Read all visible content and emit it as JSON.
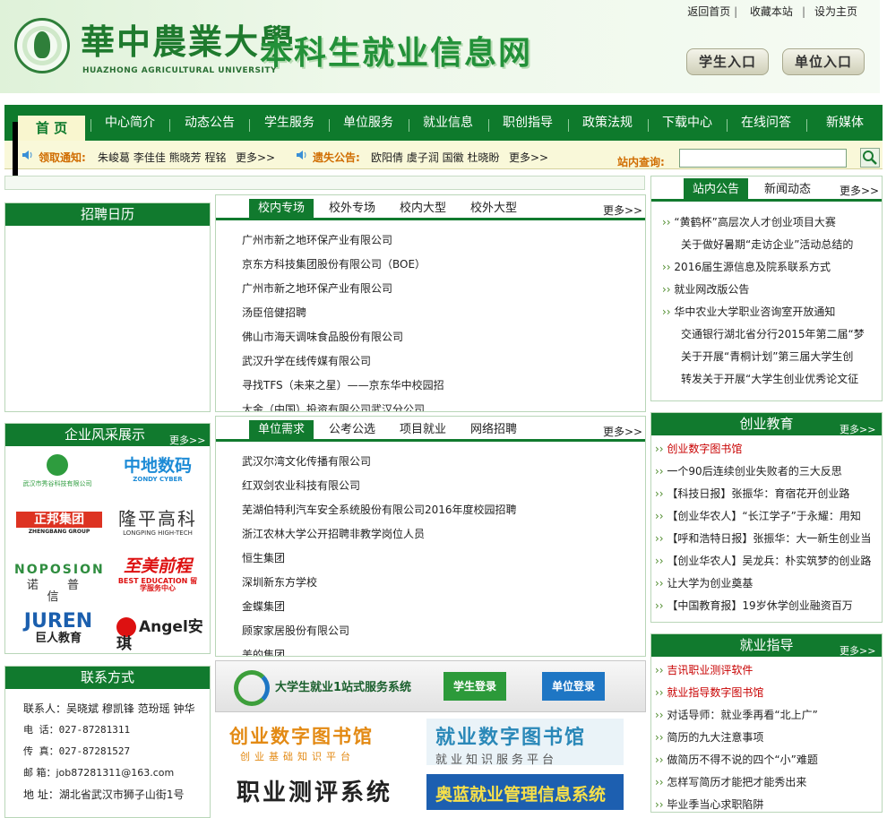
{
  "header": {
    "calligraphy": "華中農業大學",
    "univ_en": "HUAZHONG AGRICULTURAL UNIVERSITY",
    "site_title": "本科生就业信息网",
    "top_links": [
      "返回首页",
      "收藏本站",
      "设为主页"
    ],
    "student_entry": "学生入口",
    "company_entry": "单位入口"
  },
  "nav": [
    "首 页",
    "中心简介",
    "动态公告",
    "学生服务",
    "单位服务",
    "就业信息",
    "职创指导",
    "政策法规",
    "下载中心",
    "在线问答",
    "新媒体"
  ],
  "notice": {
    "label1": "领取通知:",
    "names1": "朱峻葛 李佳佳 熊晓芳 程铭",
    "more1": "更多>>",
    "label2": "遗失公告:",
    "names2": "欧阳倩 虞子润 国徽 杜晓盼",
    "more2": "更多>>",
    "search_label": "站内查询:"
  },
  "calendar": {
    "title": "招聘日历"
  },
  "recruit": {
    "tabs": [
      "校内专场",
      "校外专场",
      "校内大型",
      "校外大型"
    ],
    "more": "更多>>",
    "items": [
      "广州市新之地环保产业有限公司",
      "京东方科技集团股份有限公司（BOE）",
      "广州市新之地环保产业有限公司",
      "汤臣倍健招聘",
      "佛山市海天调味食品股份有限公司",
      "武汉升学在线传媒有限公司",
      "寻找TFS（未来之星）——京东华中校园招",
      "大金（中国）投资有限公司武汉分公司"
    ]
  },
  "demand": {
    "tabs": [
      "单位需求",
      "公考公选",
      "项目就业",
      "网络招聘"
    ],
    "more": "更多>>",
    "items": [
      "武汉尔湾文化传播有限公司",
      "红双剑农业科技有限公司",
      "芜湖伯特利汽车安全系统股份有限公司2016年度校园招聘",
      "浙江农林大学公开招聘非教学岗位人员",
      "恒生集团",
      "深圳新东方学校",
      "金蝶集团",
      "顾家家居股份有限公司",
      "美的集团"
    ]
  },
  "companies": {
    "title": "企业风采展示",
    "more": "更多>>",
    "logos": [
      {
        "name": "武汉市秀谷科技有限公司",
        "sub": ""
      },
      {
        "name": "中地数码",
        "sub": "ZONDY CYBER"
      },
      {
        "name": "正邦集团",
        "sub": "ZHENGBANG GROUP"
      },
      {
        "name": "隆平高科",
        "sub": "LONGPING HIGH-TECH"
      },
      {
        "name": "NOPOSION",
        "sub": "诺 普 信"
      },
      {
        "name": "至美前程",
        "sub": "BEST EDUCATION 留学服务中心"
      },
      {
        "name": "JUREN",
        "sub": "巨人教育"
      },
      {
        "name": "Angel安琪",
        "sub": ""
      }
    ]
  },
  "contact": {
    "title": "联系方式",
    "lines": [
      "联系人：吴晓斌 穆凯锋 范玢瑶 钟华",
      "电 话：027-87281311",
      "传 真：027-87281527",
      "邮 箱：job87281311@163.com",
      "地 址：湖北省武汉市狮子山街1号"
    ]
  },
  "banners": {
    "onestop": "大学生就业1站式服务系统",
    "student_login": "学生登录",
    "company_login": "单位登录",
    "cy_lib": "创业数字图书馆",
    "cy_lib_sub": "创业基础知识平台",
    "jy_lib": "就业数字图书馆",
    "jy_lib_sub": "就业知识服务平台",
    "test": "职业测评系统",
    "aolan": "奥蓝就业管理信息系统"
  },
  "announce": {
    "tabs": [
      "站内公告",
      "新闻动态"
    ],
    "more": "更多>>",
    "items": [
      "“黄鹤杯”高层次人才创业项目大赛",
      "关于做好暑期“走访企业”活动总结的",
      "2016届生源信息及院系联系方式",
      "就业网改版公告",
      "华中农业大学职业咨询室开放通知",
      "交通银行湖北省分行2015年第二届“梦",
      "关于开展“青桐计划”第三届大学生创",
      "转发关于开展“大学生创业优秀论文征"
    ]
  },
  "entrepreneurship": {
    "title": "创业教育",
    "more": "更多>>",
    "items": [
      "创业数字图书馆",
      "一个90后连续创业失败者的三大反思",
      "【科技日报】张振华：育宿花开创业路",
      "【创业华农人】“长江学子”于永耀：用知",
      "【呼和浩特日报】张振华：大一新生创业当",
      "【创业华农人】吴龙兵：朴实筑梦的创业路",
      "让大学为创业奠基",
      "【中国教育报】19岁休学创业融资百万"
    ]
  },
  "guidance": {
    "title": "就业指导",
    "more": "更多>>",
    "items": [
      "吉讯职业测评软件",
      "就业指导数字图书馆",
      "对话导师：就业季再看“北上广”",
      "简历的九大注意事项",
      "做简历不得不说的四个“小”难题",
      "怎样写简历才能把才能秀出来",
      "毕业季当心求职陷阱"
    ]
  },
  "colors": {
    "brand_green": "#117a2e",
    "notice_orange": "#d06c00",
    "link_red": "#c80000"
  }
}
